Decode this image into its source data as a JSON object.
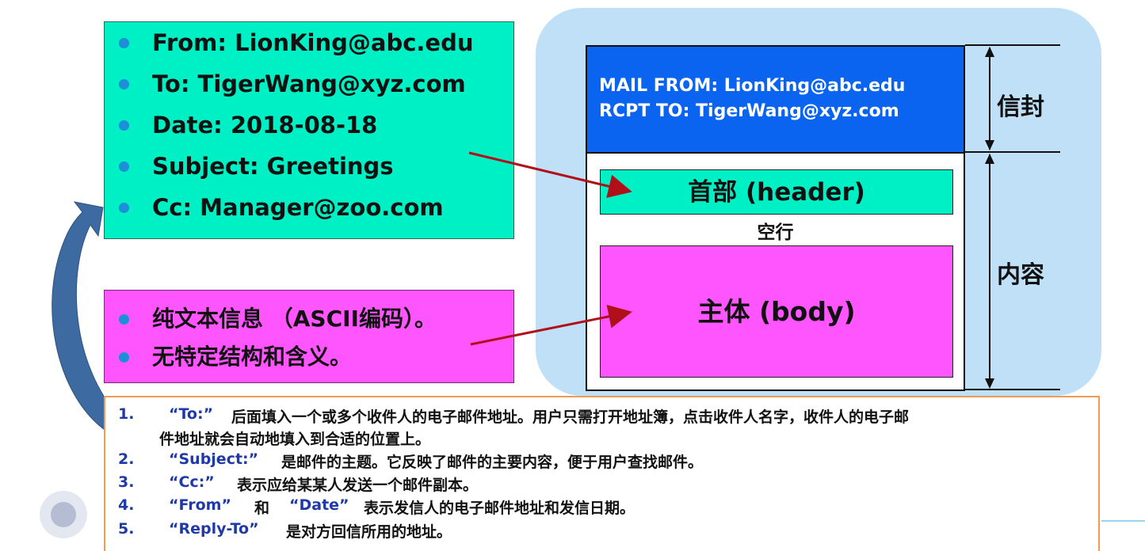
{
  "header_fields": [
    "From: LionKing@abc.edu",
    "To: TigerWang@xyz.com",
    "Date: 2018-08-18",
    "Subject: Greetings",
    "Cc: Manager@zoo.com"
  ],
  "body_notes": [
    "纯文本信息 （ASCII编码）。",
    "无特定结构和含义。"
  ],
  "mail": {
    "envelope_line1": "MAIL FROM: LionKing@abc.edu",
    "envelope_line2": "RCPT TO: TigerWang@xyz.com",
    "header_label": "首部 (header)",
    "blank_line": "空行",
    "body_label": "主体 (body)",
    "side_envelope": "信封",
    "side_content": "内容"
  },
  "notes": [
    {
      "num": "1.",
      "key": "“To:”",
      "text": "后面填入一个或多个收件人的电子邮件地址。用户只需打开地址簿，点击收件人名字，收件人的电子邮"
    },
    {
      "num": "",
      "key": "",
      "text": "件地址就会自动地填入到合适的位置上。"
    },
    {
      "num": "2.",
      "key": "“Subject:”",
      "text": "是邮件的主题。它反映了邮件的主要内容，便于用户查找邮件。"
    },
    {
      "num": "3.",
      "key": "“Cc:”",
      "text": "表示应给某某人发送一个邮件副本。"
    },
    {
      "num": "4.",
      "key": "“From”",
      "text": "和",
      "key2": "“Date”",
      "text2": "表示发信人的电子邮件地址和发信日期。"
    },
    {
      "num": "5.",
      "key": "“Reply-To”",
      "text": "是对方回信所用的地址。"
    }
  ],
  "colors": {
    "header_fill": "#00f0c6",
    "body_fill": "#ff55ff",
    "envelope_fill": "#0a64f0",
    "background_panel": "#bfe0f6",
    "arrow": "#b0101a",
    "notes_border": "#f39a50",
    "note_key": "#1f3aa8"
  }
}
